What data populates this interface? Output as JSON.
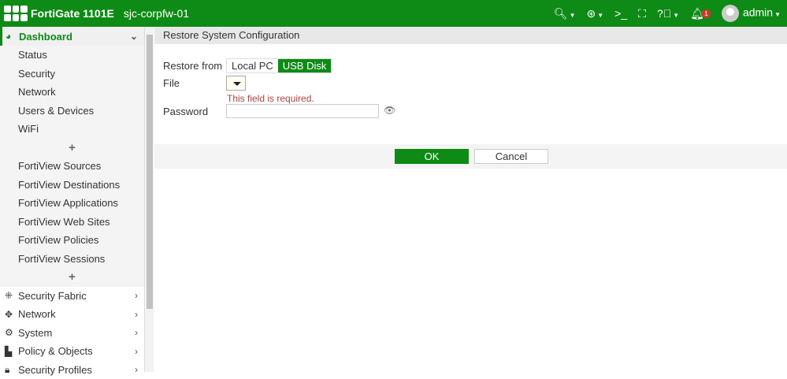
{
  "topbar": {
    "brand": "FortiGate 1101E",
    "hostname": "sjc-corpfw-01",
    "user": "admin",
    "notification_count": "1"
  },
  "sidebar": {
    "dashboard": "Dashboard",
    "dashboard_items": [
      "Status",
      "Security",
      "Network",
      "Users & Devices",
      "WiFi"
    ],
    "fortiview_items": [
      "FortiView Sources",
      "FortiView Destinations",
      "FortiView Applications",
      "FortiView Web Sites",
      "FortiView Policies",
      "FortiView Sessions"
    ],
    "menu": [
      {
        "label": "Security Fabric",
        "icon": "security-fabric-icon"
      },
      {
        "label": "Network",
        "icon": "network-icon"
      },
      {
        "label": "System",
        "icon": "gear-icon"
      },
      {
        "label": "Policy & Objects",
        "icon": "policy-icon"
      },
      {
        "label": "Security Profiles",
        "icon": "lock-icon"
      }
    ]
  },
  "page": {
    "title": "Restore System Configuration",
    "restore_from_label": "Restore from",
    "options": [
      "Local PC",
      "USB Disk"
    ],
    "selected": "USB Disk",
    "file_label": "File",
    "file_error": "This field is required.",
    "password_label": "Password",
    "password_value": "",
    "ok": "OK",
    "cancel": "Cancel"
  },
  "colors": {
    "brand": "#0e8a16",
    "error": "#a94442"
  }
}
